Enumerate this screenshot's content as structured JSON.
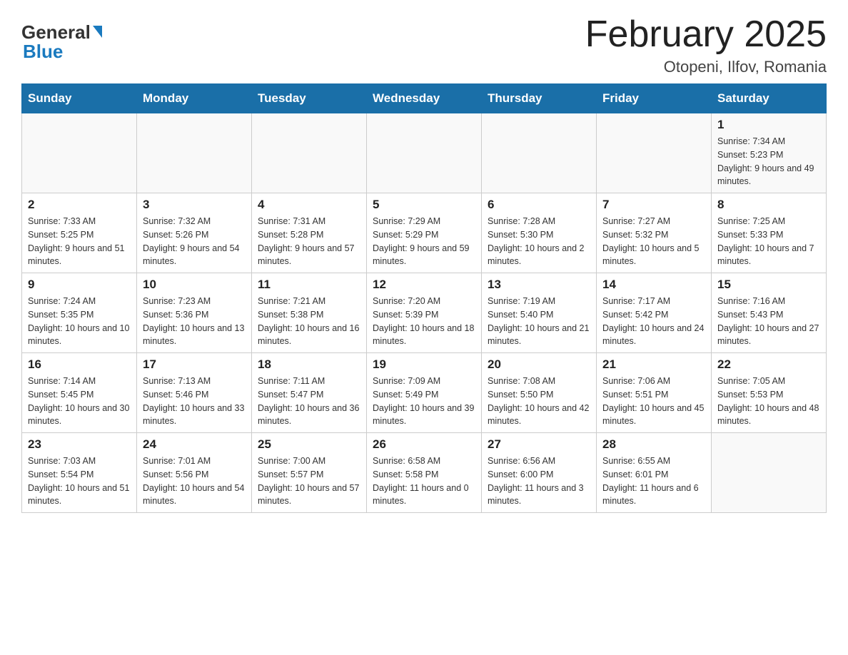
{
  "header": {
    "logo_general": "General",
    "logo_blue": "Blue",
    "month_title": "February 2025",
    "location": "Otopeni, Ilfov, Romania"
  },
  "days_of_week": [
    "Sunday",
    "Monday",
    "Tuesday",
    "Wednesday",
    "Thursday",
    "Friday",
    "Saturday"
  ],
  "weeks": [
    [
      {
        "day": "",
        "info": ""
      },
      {
        "day": "",
        "info": ""
      },
      {
        "day": "",
        "info": ""
      },
      {
        "day": "",
        "info": ""
      },
      {
        "day": "",
        "info": ""
      },
      {
        "day": "",
        "info": ""
      },
      {
        "day": "1",
        "info": "Sunrise: 7:34 AM\nSunset: 5:23 PM\nDaylight: 9 hours and 49 minutes."
      }
    ],
    [
      {
        "day": "2",
        "info": "Sunrise: 7:33 AM\nSunset: 5:25 PM\nDaylight: 9 hours and 51 minutes."
      },
      {
        "day": "3",
        "info": "Sunrise: 7:32 AM\nSunset: 5:26 PM\nDaylight: 9 hours and 54 minutes."
      },
      {
        "day": "4",
        "info": "Sunrise: 7:31 AM\nSunset: 5:28 PM\nDaylight: 9 hours and 57 minutes."
      },
      {
        "day": "5",
        "info": "Sunrise: 7:29 AM\nSunset: 5:29 PM\nDaylight: 9 hours and 59 minutes."
      },
      {
        "day": "6",
        "info": "Sunrise: 7:28 AM\nSunset: 5:30 PM\nDaylight: 10 hours and 2 minutes."
      },
      {
        "day": "7",
        "info": "Sunrise: 7:27 AM\nSunset: 5:32 PM\nDaylight: 10 hours and 5 minutes."
      },
      {
        "day": "8",
        "info": "Sunrise: 7:25 AM\nSunset: 5:33 PM\nDaylight: 10 hours and 7 minutes."
      }
    ],
    [
      {
        "day": "9",
        "info": "Sunrise: 7:24 AM\nSunset: 5:35 PM\nDaylight: 10 hours and 10 minutes."
      },
      {
        "day": "10",
        "info": "Sunrise: 7:23 AM\nSunset: 5:36 PM\nDaylight: 10 hours and 13 minutes."
      },
      {
        "day": "11",
        "info": "Sunrise: 7:21 AM\nSunset: 5:38 PM\nDaylight: 10 hours and 16 minutes."
      },
      {
        "day": "12",
        "info": "Sunrise: 7:20 AM\nSunset: 5:39 PM\nDaylight: 10 hours and 18 minutes."
      },
      {
        "day": "13",
        "info": "Sunrise: 7:19 AM\nSunset: 5:40 PM\nDaylight: 10 hours and 21 minutes."
      },
      {
        "day": "14",
        "info": "Sunrise: 7:17 AM\nSunset: 5:42 PM\nDaylight: 10 hours and 24 minutes."
      },
      {
        "day": "15",
        "info": "Sunrise: 7:16 AM\nSunset: 5:43 PM\nDaylight: 10 hours and 27 minutes."
      }
    ],
    [
      {
        "day": "16",
        "info": "Sunrise: 7:14 AM\nSunset: 5:45 PM\nDaylight: 10 hours and 30 minutes."
      },
      {
        "day": "17",
        "info": "Sunrise: 7:13 AM\nSunset: 5:46 PM\nDaylight: 10 hours and 33 minutes."
      },
      {
        "day": "18",
        "info": "Sunrise: 7:11 AM\nSunset: 5:47 PM\nDaylight: 10 hours and 36 minutes."
      },
      {
        "day": "19",
        "info": "Sunrise: 7:09 AM\nSunset: 5:49 PM\nDaylight: 10 hours and 39 minutes."
      },
      {
        "day": "20",
        "info": "Sunrise: 7:08 AM\nSunset: 5:50 PM\nDaylight: 10 hours and 42 minutes."
      },
      {
        "day": "21",
        "info": "Sunrise: 7:06 AM\nSunset: 5:51 PM\nDaylight: 10 hours and 45 minutes."
      },
      {
        "day": "22",
        "info": "Sunrise: 7:05 AM\nSunset: 5:53 PM\nDaylight: 10 hours and 48 minutes."
      }
    ],
    [
      {
        "day": "23",
        "info": "Sunrise: 7:03 AM\nSunset: 5:54 PM\nDaylight: 10 hours and 51 minutes."
      },
      {
        "day": "24",
        "info": "Sunrise: 7:01 AM\nSunset: 5:56 PM\nDaylight: 10 hours and 54 minutes."
      },
      {
        "day": "25",
        "info": "Sunrise: 7:00 AM\nSunset: 5:57 PM\nDaylight: 10 hours and 57 minutes."
      },
      {
        "day": "26",
        "info": "Sunrise: 6:58 AM\nSunset: 5:58 PM\nDaylight: 11 hours and 0 minutes."
      },
      {
        "day": "27",
        "info": "Sunrise: 6:56 AM\nSunset: 6:00 PM\nDaylight: 11 hours and 3 minutes."
      },
      {
        "day": "28",
        "info": "Sunrise: 6:55 AM\nSunset: 6:01 PM\nDaylight: 11 hours and 6 minutes."
      },
      {
        "day": "",
        "info": ""
      }
    ]
  ]
}
